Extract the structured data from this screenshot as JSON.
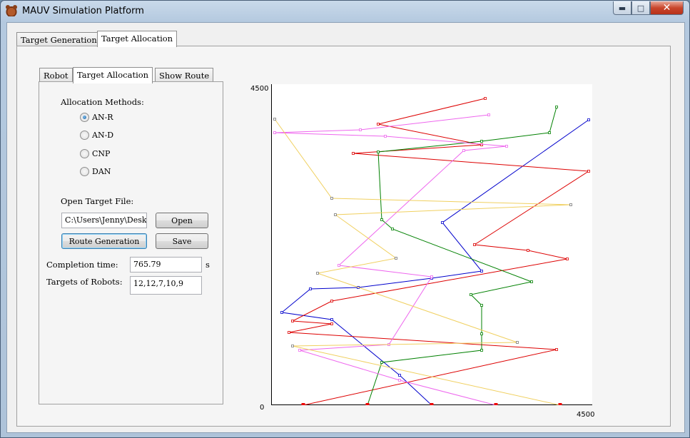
{
  "window": {
    "title": "MAUV Simulation Platform",
    "minimize": "▬",
    "maximize": "□",
    "close": "✕"
  },
  "outer_tabs": [
    "Target Generation",
    "Target Allocation"
  ],
  "inner_tabs": [
    "Robot",
    "Target Allocation",
    "Show Route"
  ],
  "form": {
    "allocation_label": "Allocation Methods:",
    "methods": [
      {
        "label": "AN-R",
        "checked": true
      },
      {
        "label": "AN-D",
        "checked": false
      },
      {
        "label": "CNP",
        "checked": false
      },
      {
        "label": "DAN",
        "checked": false
      }
    ],
    "open_file_label": "Open Target File:",
    "file_path": "C:\\Users\\Jenny\\Desk",
    "open_button": "Open",
    "route_button": "Route Generation",
    "save_button": "Save",
    "completion_label": "Completion time:",
    "completion_value": "765.79",
    "completion_unit": "s",
    "targets_label": "Targets of Robots:",
    "targets_value": "12,12,7,10,9"
  },
  "chart_data": {
    "type": "line",
    "xlim": [
      0,
      4500
    ],
    "ylim": [
      0,
      4500
    ],
    "tick_labels": {
      "y_max": "4500",
      "y_min": "0",
      "x_max": "4500"
    },
    "series": [
      {
        "color": "#0000cc",
        "depots": [
          2250,
          0
        ],
        "points": [
          [
            2250,
            0
          ],
          [
            1800,
            420
          ],
          [
            850,
            1200
          ],
          [
            150,
            1300
          ],
          [
            550,
            1630
          ],
          [
            1220,
            1650
          ],
          [
            2250,
            1780
          ],
          [
            2950,
            1880
          ],
          [
            2400,
            2560
          ],
          [
            4450,
            4000
          ]
        ]
      },
      {
        "color": "#dd0000",
        "depots": [
          450,
          0
        ],
        "points": [
          [
            450,
            0
          ],
          [
            4000,
            780
          ],
          [
            250,
            1020
          ],
          [
            850,
            1140
          ],
          [
            300,
            1180
          ],
          [
            850,
            1460
          ],
          [
            4150,
            2050
          ],
          [
            3600,
            2170
          ],
          [
            2850,
            2250
          ],
          [
            4450,
            3280
          ],
          [
            1150,
            3530
          ],
          [
            2950,
            3650
          ],
          [
            1500,
            3940
          ],
          [
            3000,
            4300
          ]
        ]
      },
      {
        "color": "#008000",
        "depots": [
          1350,
          0
        ],
        "points": [
          [
            1350,
            0
          ],
          [
            1550,
            600
          ],
          [
            2950,
            770
          ],
          [
            2950,
            1000
          ],
          [
            2950,
            1400
          ],
          [
            2800,
            1550
          ],
          [
            3650,
            1730
          ],
          [
            1700,
            2470
          ],
          [
            1550,
            2600
          ],
          [
            1500,
            3550
          ],
          [
            2950,
            3700
          ],
          [
            3900,
            3820
          ],
          [
            4000,
            4180
          ]
        ]
      },
      {
        "color": "#ee66ee",
        "depots": [
          3150,
          0
        ],
        "points": [
          [
            3150,
            0
          ],
          [
            1800,
            350
          ],
          [
            400,
            770
          ],
          [
            1650,
            850
          ],
          [
            2250,
            1800
          ],
          [
            950,
            1960
          ],
          [
            2700,
            3570
          ],
          [
            3300,
            3630
          ],
          [
            1600,
            3770
          ],
          [
            50,
            3820
          ],
          [
            1250,
            3860
          ],
          [
            3050,
            4070
          ]
        ]
      },
      {
        "color": "#f0d060",
        "depots": [
          4050,
          0
        ],
        "points": [
          [
            4050,
            0
          ],
          [
            300,
            830
          ],
          [
            3450,
            880
          ],
          [
            650,
            1850
          ],
          [
            1750,
            2060
          ],
          [
            900,
            2670
          ],
          [
            4200,
            2810
          ],
          [
            850,
            2900
          ],
          [
            50,
            4010
          ]
        ]
      }
    ]
  }
}
